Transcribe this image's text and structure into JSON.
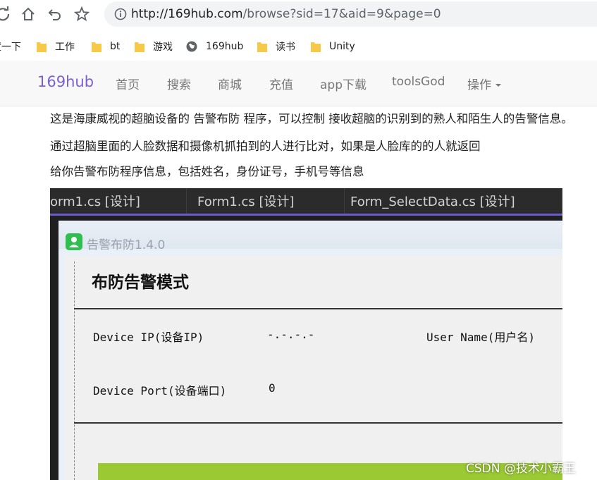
{
  "browser": {
    "url_host": "http://169hub.com",
    "url_path": "/browse?sid=17&aid=9&page=0",
    "icons": [
      "reload-icon",
      "home-icon",
      "back-icon",
      "star-icon",
      "info-icon"
    ]
  },
  "bookmarks": [
    {
      "label": "度一下",
      "icon": "folder-icon"
    },
    {
      "label": "工作",
      "icon": "folder-icon"
    },
    {
      "label": "bt",
      "icon": "folder-icon"
    },
    {
      "label": "游戏",
      "icon": "folder-icon"
    },
    {
      "label": "169hub",
      "icon": "globe-icon"
    },
    {
      "label": "读书",
      "icon": "folder-icon"
    },
    {
      "label": "Unity",
      "icon": "folder-icon"
    }
  ],
  "nav": {
    "brand": "169hub",
    "links": [
      "首页",
      "搜索",
      "商城",
      "充值",
      "app下载",
      "toolsGod",
      "操作"
    ],
    "brand_color": "#7b5fd6"
  },
  "article": {
    "paragraphs": [
      "这是海康威视的超脑设备的 告警布防 程序，可以控制 接收超脑的识别到的熟人和陌生人的告警信息。",
      "通过超脑里面的人脸数据和摄像机抓拍到的人进行比对，如果是人脸库的的人就返回",
      "给你告警布防程序信息，包括姓名，身份证号，手机号等信息"
    ]
  },
  "ide": {
    "tabs": [
      "orm1.cs [设计]",
      "Form1.cs [设计]",
      "Form_SelectData.cs [设计]"
    ],
    "window_title": "告警布防1.4.0",
    "heading": "布防告警模式",
    "device_ip_label": "Device IP(设备IP)",
    "device_ip_value": "-.-.-.-",
    "user_name_label": "User Name(用户名)",
    "device_port_label": "Device Port(设备端口)",
    "device_port_value": "0",
    "accent_color": "#9ac934"
  },
  "watermark": "CSDN @技术小霸王"
}
